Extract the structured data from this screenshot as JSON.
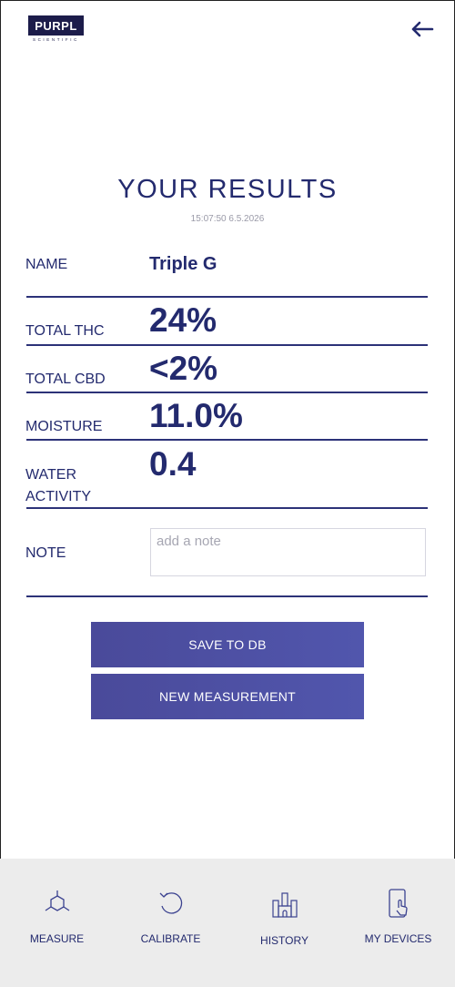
{
  "header": {
    "logo_text": "PURPL",
    "logo_sub": "SCIENTIFIC",
    "back_icon": "arrow-left-icon"
  },
  "results": {
    "title": "YOUR RESULTS",
    "timestamp": "15:07:50 6.5.2026",
    "name_label": "NAME",
    "name_value": "Triple G",
    "thc_label": "TOTAL THC",
    "thc_value": "24%",
    "cbd_label": "TOTAL CBD",
    "cbd_value": "<2%",
    "moisture_label": "MOISTURE",
    "moisture_value": "11.0%",
    "water_label_1": "WATER",
    "water_label_2": "ACTIVITY",
    "water_value": "0.4",
    "note_label": "NOTE",
    "note_placeholder": "add a note",
    "note_value": ""
  },
  "actions": {
    "save_label": "SAVE TO DB",
    "new_label": "NEW MEASUREMENT"
  },
  "tabs": [
    {
      "label": "MEASURE",
      "icon": "molecule-icon"
    },
    {
      "label": "CALIBRATE",
      "icon": "refresh-icon"
    },
    {
      "label": "HISTORY",
      "icon": "castle-icon"
    },
    {
      "label": "MY DEVICES",
      "icon": "phone-touch-icon"
    }
  ],
  "colors": {
    "primary": "#232a6e",
    "button": "#4f53a8",
    "tabbar": "#ececec"
  }
}
